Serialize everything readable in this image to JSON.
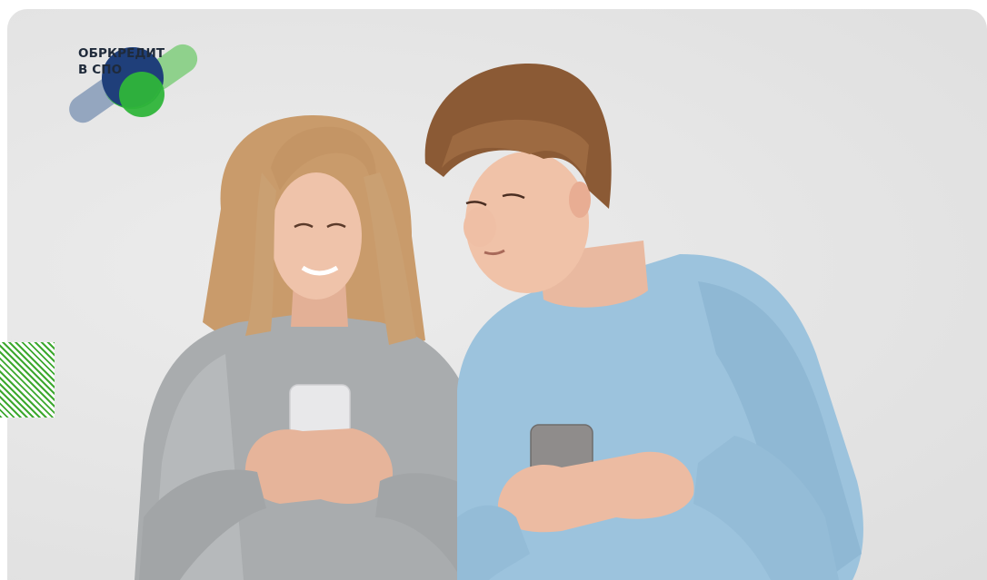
{
  "logo": {
    "line1": "ОБРКРЕДИТ",
    "line2": "В СПО",
    "colors": {
      "navy": "#1f3f7a",
      "green": "#2fb53a",
      "light_green": "#8fd18c",
      "grey_blue": "#8fa2bd"
    }
  },
  "photo": {
    "subjects": [
      "girl-in-grey-sweater-with-phone",
      "boy-in-blue-sweater-with-phone"
    ],
    "colors": {
      "background": "#e6e6e6",
      "grey_sweater": "#a9acae",
      "blue_sweater": "#9cc3dd",
      "hair_blonde": "#c79a6a",
      "hair_brown": "#8a5a36",
      "skin": "#e8b9a0"
    }
  },
  "decor": {
    "stripe_color": "#3da82f"
  }
}
